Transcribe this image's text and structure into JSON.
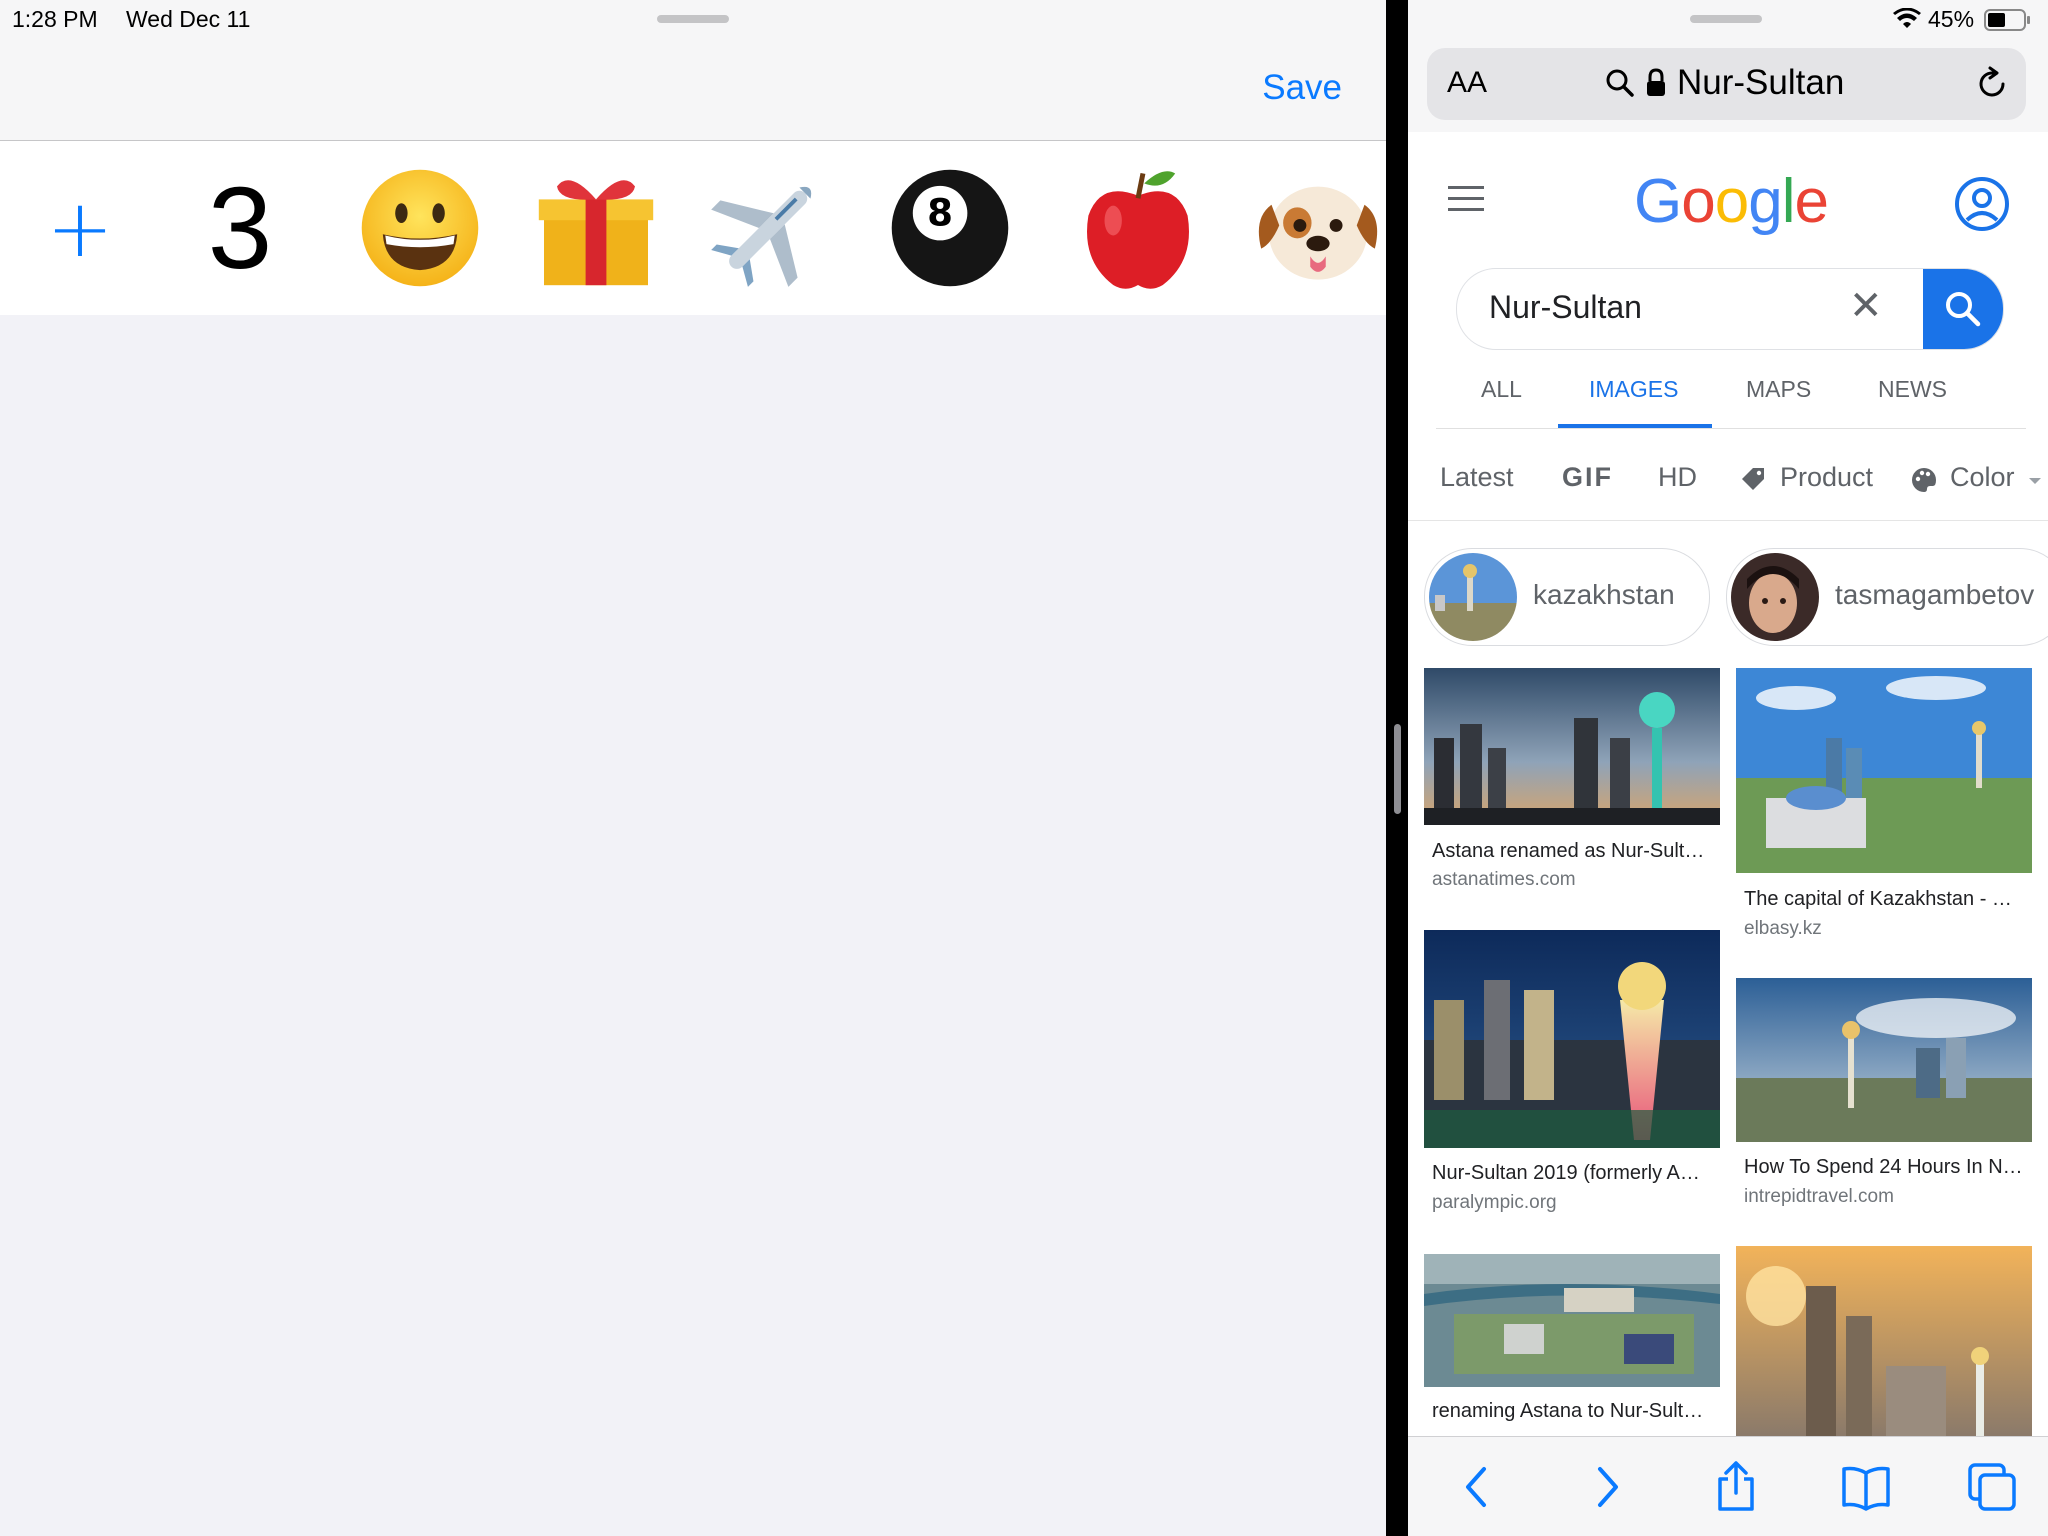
{
  "status_bar": {
    "time": "1:28 PM",
    "date": "Wed Dec 11",
    "battery": "45%"
  },
  "left_pane": {
    "save_label": "Save",
    "emoji_row": {
      "plus_label": "+",
      "count_label": "3",
      "emojis": [
        "😀",
        "🎁",
        "✈️",
        "🎱",
        "🍎",
        "🐶"
      ],
      "emoji_icons": [
        "grinning-face-icon",
        "gift-icon",
        "airplane-icon",
        "pool-8-ball-icon",
        "red-apple-icon",
        "dog-face-icon"
      ]
    }
  },
  "safari": {
    "aa_label": "AA",
    "url_text": "Nur-Sultan",
    "accent_color": "#0a7aff"
  },
  "google": {
    "logo_text": "Google",
    "search_value": "Nur-Sultan",
    "clear_label": "✕",
    "tabs": [
      {
        "label": "ALL",
        "active": false
      },
      {
        "label": "IMAGES",
        "active": true
      },
      {
        "label": "MAPS",
        "active": false
      },
      {
        "label": "NEWS",
        "active": false
      }
    ],
    "filters": [
      "Latest",
      "GIF",
      "HD",
      "Product",
      "Color"
    ],
    "chips": [
      {
        "label": "kazakhstan"
      },
      {
        "label": "tasmagambetov"
      }
    ],
    "results": [
      {
        "title": "Astana renamed as Nur-Sult…",
        "domain": "astanatimes.com"
      },
      {
        "title": "The capital of Kazakhstan - …",
        "domain": "elbasy.kz"
      },
      {
        "title": "Nur-Sultan 2019 (formerly A…",
        "domain": "paralympic.org"
      },
      {
        "title": "How To Spend 24 Hours In N…",
        "domain": "intrepidtravel.com"
      },
      {
        "title": "renaming Astana to Nur-Sult…",
        "domain": ""
      },
      {
        "title": "",
        "domain": ""
      }
    ],
    "brand_blue": "#1a73e8"
  }
}
